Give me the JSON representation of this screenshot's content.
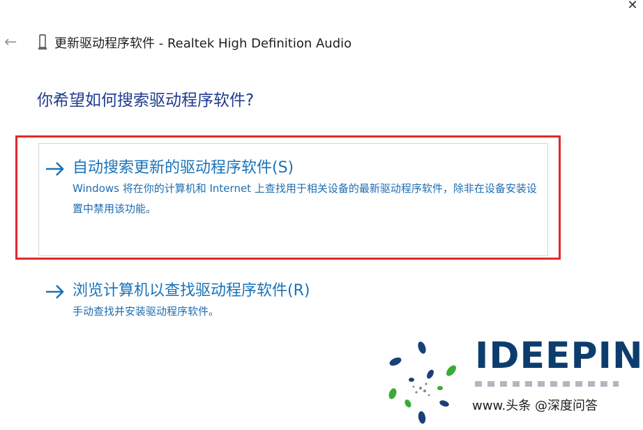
{
  "window": {
    "close_glyph": "✕",
    "back_glyph": "←"
  },
  "header": {
    "title": "更新驱动程序软件 - Realtek High Definition Audio"
  },
  "main": {
    "question": "你希望如何搜索驱动程序软件?",
    "options": [
      {
        "title": "自动搜索更新的驱动程序软件(S)",
        "description": "Windows 将在你的计算机和 Internet 上查找用于相关设备的最新驱动程序软件，除非在设备安装设置中禁用该功能。"
      },
      {
        "title": "浏览计算机以查找驱动程序软件(R)",
        "description": "手动查找并安装驱动程序软件。"
      }
    ]
  },
  "watermark": {
    "brand": "IDEEPIN",
    "url": "www.头条 @深度问答"
  },
  "colors": {
    "accent": "#1a73b8",
    "question": "#1f3b8f",
    "highlight": "#e0292c"
  },
  "icons": [
    "close-icon",
    "back-arrow-icon",
    "device-icon",
    "arrow-right-icon",
    "logo-icon"
  ]
}
